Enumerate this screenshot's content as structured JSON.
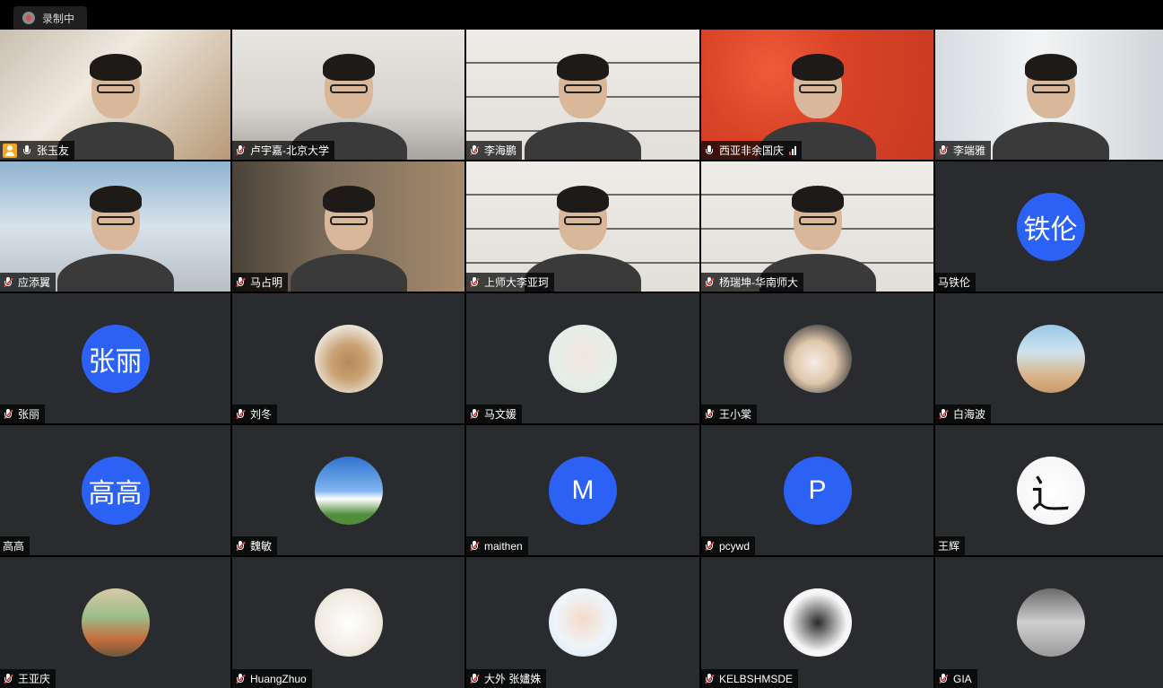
{
  "recording": {
    "label": "录制中"
  },
  "tiles": [
    {
      "name": "张玉友",
      "type": "video",
      "bg": "bg-room1",
      "host": true
    },
    {
      "name": "卢宇嘉-北京大学",
      "type": "video",
      "bg": "bg-room2"
    },
    {
      "name": "李海鹏",
      "type": "video",
      "bg": "bg-shelf"
    },
    {
      "name": "西亚非余国庆",
      "type": "video",
      "bg": "bg-red",
      "speaking": true
    },
    {
      "name": "李端雅",
      "type": "video",
      "bg": "bg-bright"
    },
    {
      "name": "应添翼",
      "type": "video",
      "bg": "bg-dorm"
    },
    {
      "name": "马占明",
      "type": "video",
      "bg": "bg-wood"
    },
    {
      "name": "上师大李亚珂",
      "type": "video",
      "bg": "bg-shelf"
    },
    {
      "name": "杨瑞坤-华南师大",
      "type": "video",
      "bg": "bg-shelf"
    },
    {
      "name": "马铁伦",
      "type": "text-avatar",
      "avatar_text": "铁伦"
    },
    {
      "name": "张丽",
      "type": "text-avatar",
      "avatar_text": "张丽"
    },
    {
      "name": "刘冬",
      "type": "image-avatar",
      "avatar_icon": "sculpture-photo"
    },
    {
      "name": "马文媛",
      "type": "image-avatar",
      "avatar_icon": "illustration-girl"
    },
    {
      "name": "王小棠",
      "type": "image-avatar",
      "avatar_icon": "cat-photo"
    },
    {
      "name": "白海波",
      "type": "image-avatar",
      "avatar_icon": "beach-photo"
    },
    {
      "name": "高高",
      "type": "text-avatar",
      "avatar_text": "高高"
    },
    {
      "name": "魏敏",
      "type": "image-avatar",
      "avatar_icon": "sky-landscape"
    },
    {
      "name": "maithen",
      "type": "text-avatar",
      "avatar_text": "M"
    },
    {
      "name": "pcywd",
      "type": "text-avatar",
      "avatar_text": "P"
    },
    {
      "name": "王辉",
      "type": "image-avatar",
      "avatar_icon": "calligraphy-character"
    },
    {
      "name": "王亚庆",
      "type": "image-avatar",
      "avatar_icon": "running-photo"
    },
    {
      "name": "HuangZhuo",
      "type": "image-avatar",
      "avatar_icon": "tiger-drawing"
    },
    {
      "name": "大外 张嫿姝",
      "type": "image-avatar",
      "avatar_icon": "portrait-photo"
    },
    {
      "name": "KELBSHMSDE",
      "type": "image-avatar",
      "avatar_icon": "silhouette-photo"
    },
    {
      "name": "GIA",
      "type": "image-avatar",
      "avatar_icon": "bw-street-photo"
    }
  ],
  "colors": {
    "avatar_blue": "#2b62f5",
    "tile_bg": "#2a2b2e",
    "muted_red": "#e34848",
    "host_orange": "#f5a623"
  }
}
